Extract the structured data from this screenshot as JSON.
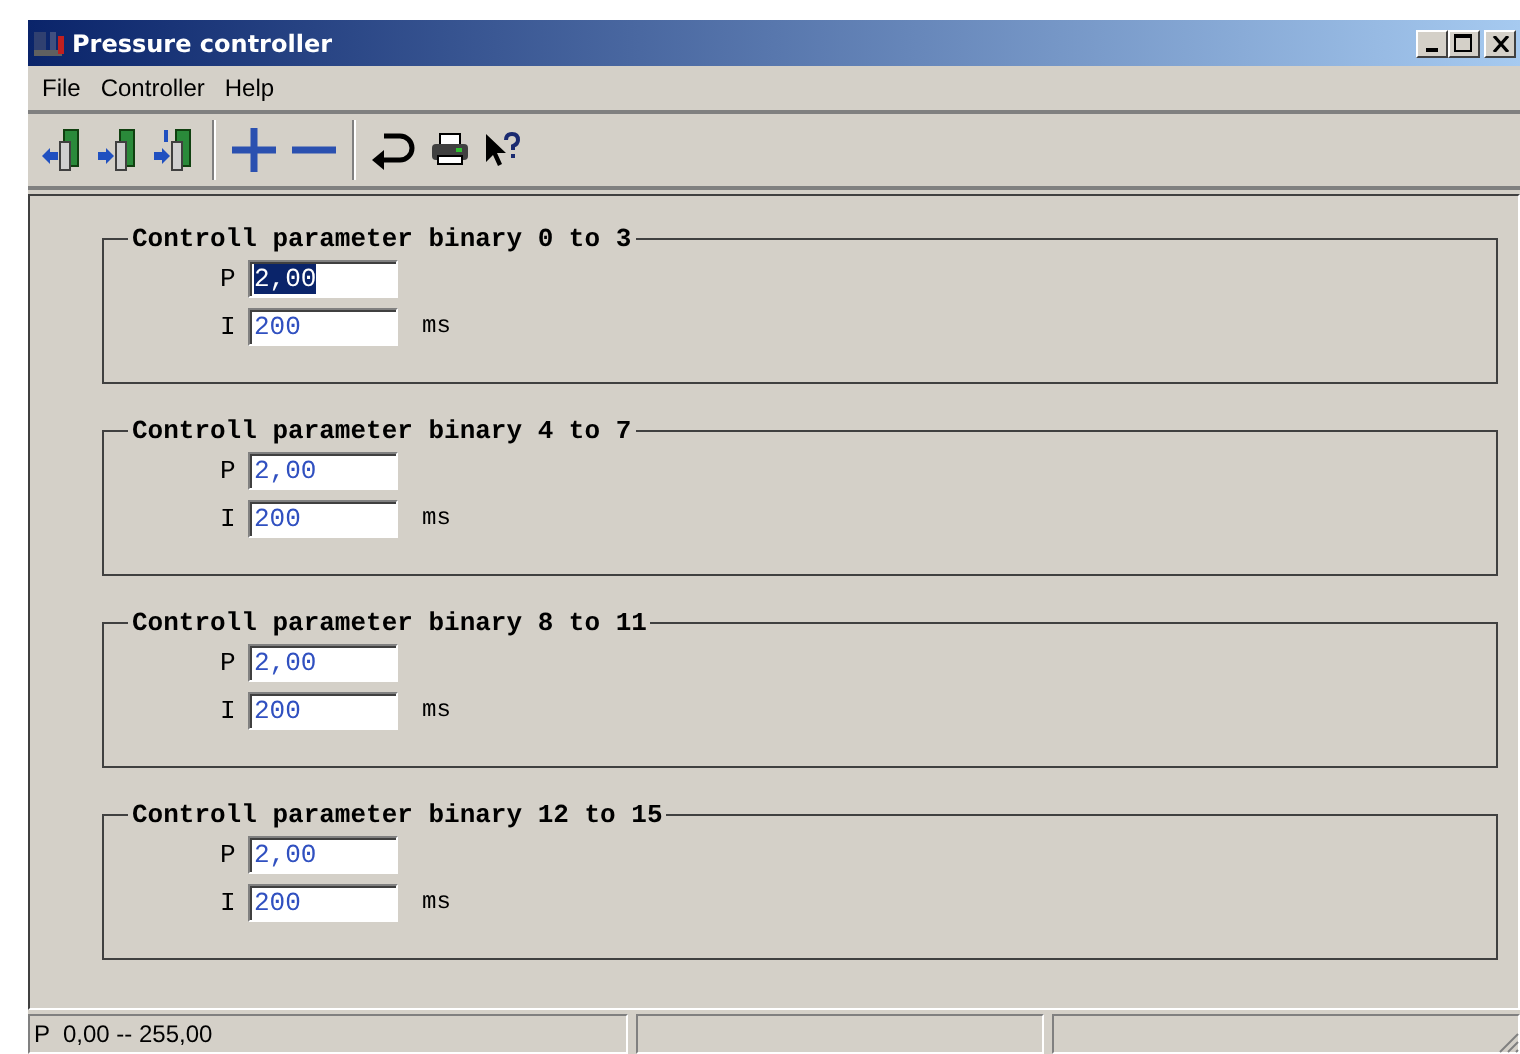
{
  "window": {
    "title": "Pressure controller"
  },
  "menu": [
    "File",
    "Controller",
    "Help"
  ],
  "toolbar": [
    {
      "kind": "card-left"
    },
    {
      "kind": "card-right"
    },
    {
      "kind": "card-number"
    },
    {
      "kind": "sep"
    },
    {
      "kind": "plus"
    },
    {
      "kind": "minus"
    },
    {
      "kind": "sep"
    },
    {
      "kind": "return"
    },
    {
      "kind": "print"
    },
    {
      "kind": "help"
    }
  ],
  "groups": [
    {
      "title": "Controll parameter binary 0 to 3",
      "p_label": "P",
      "p_value": "2,00",
      "p_selected": true,
      "i_label": "I",
      "i_value": "200",
      "i_unit": "ms"
    },
    {
      "title": "Controll parameter binary 4 to 7",
      "p_label": "P",
      "p_value": "2,00",
      "p_selected": false,
      "i_label": "I",
      "i_value": "200",
      "i_unit": "ms"
    },
    {
      "title": "Controll parameter binary 8 to 11",
      "p_label": "P",
      "p_value": "2,00",
      "p_selected": false,
      "i_label": "I",
      "i_value": "200",
      "i_unit": "ms"
    },
    {
      "title": "Controll parameter binary 12 to 15",
      "p_label": "P",
      "p_value": "2,00",
      "p_selected": false,
      "i_label": "I",
      "i_value": "200",
      "i_unit": "ms"
    }
  ],
  "status_bar": {
    "text": "P  0,00 -- 255,00"
  }
}
